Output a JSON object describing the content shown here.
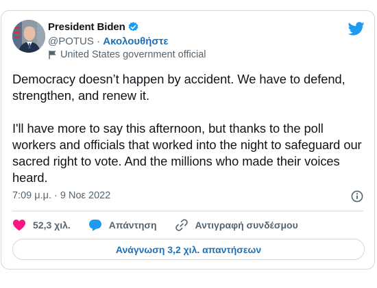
{
  "author": {
    "name": "President Biden",
    "handle": "@POTUS",
    "separator": " · ",
    "follow_label": "Ακολουθήστε",
    "account_label": "United States government official"
  },
  "tweet": {
    "text": "Democracy doesn’t happen by accident. We have to defend, strengthen, and renew it.\n\nI'll have more to say this afternoon, but thanks to the poll workers and officials that worked into the night to safeguard our sacred right to vote. And the millions who made their voices heard.",
    "timestamp": "7:09 μ.μ. · 9 Νοε 2022"
  },
  "actions": {
    "likes_count": "52,3 χιλ.",
    "reply_label": "Απάντηση",
    "copy_link_label": "Αντιγραφή συνδέσμου"
  },
  "read_replies_label": "Ανάγνωση 3,2 χιλ. απαντήσεων",
  "icons": {
    "brand": "twitter-bird-icon",
    "verified": "verified-badge-icon",
    "label": "flag-icon",
    "info": "info-icon",
    "like": "heart-icon",
    "reply": "reply-bubble-icon",
    "copy": "link-icon"
  },
  "colors": {
    "twitter_blue": "#1d9bf0",
    "link_blue": "#1d70b8",
    "like_pink": "#f91880",
    "text": "#0f1419",
    "secondary_text": "#536471",
    "border": "#cfd9de"
  }
}
